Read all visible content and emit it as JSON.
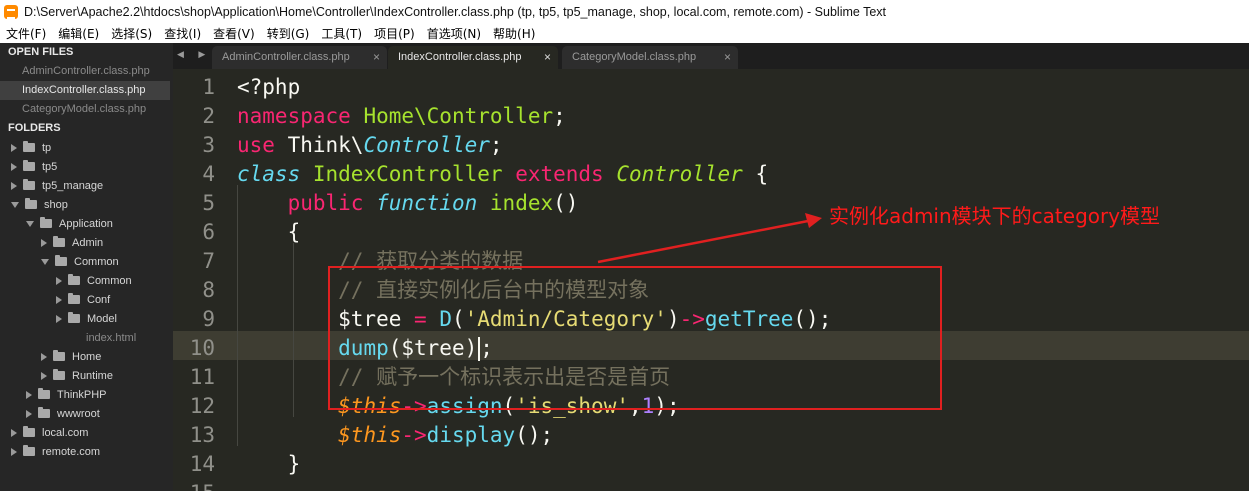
{
  "window": {
    "title": "D:\\Server\\Apache2.2\\htdocs\\shop\\Application\\Home\\Controller\\IndexController.class.php (tp, tp5, tp5_manage, shop, local.com, remote.com) - Sublime Text"
  },
  "menu": [
    "文件(F)",
    "编辑(E)",
    "选择(S)",
    "查找(I)",
    "查看(V)",
    "转到(G)",
    "工具(T)",
    "项目(P)",
    "首选项(N)",
    "帮助(H)"
  ],
  "sidebar": {
    "open_files_header": "OPEN FILES",
    "open_files": [
      "AdminController.class.php",
      "IndexController.class.php",
      "CategoryModel.class.php"
    ],
    "folders_header": "FOLDERS",
    "tree": [
      {
        "label": "tp",
        "type": "folder",
        "expanded": false,
        "depth": 0
      },
      {
        "label": "tp5",
        "type": "folder",
        "expanded": false,
        "depth": 0
      },
      {
        "label": "tp5_manage",
        "type": "folder",
        "expanded": false,
        "depth": 0
      },
      {
        "label": "shop",
        "type": "folder",
        "expanded": true,
        "depth": 0
      },
      {
        "label": "Application",
        "type": "folder",
        "expanded": true,
        "depth": 1
      },
      {
        "label": "Admin",
        "type": "folder",
        "expanded": false,
        "depth": 2
      },
      {
        "label": "Common",
        "type": "folder",
        "expanded": true,
        "depth": 2
      },
      {
        "label": "Common",
        "type": "folder",
        "expanded": false,
        "depth": 3
      },
      {
        "label": "Conf",
        "type": "folder",
        "expanded": false,
        "depth": 3
      },
      {
        "label": "Model",
        "type": "folder",
        "expanded": false,
        "depth": 3
      },
      {
        "label": "index.html",
        "type": "file",
        "expanded": false,
        "depth": 3
      },
      {
        "label": "Home",
        "type": "folder",
        "expanded": false,
        "depth": 2
      },
      {
        "label": "Runtime",
        "type": "folder",
        "expanded": false,
        "depth": 2
      },
      {
        "label": "ThinkPHP",
        "type": "folder",
        "expanded": false,
        "depth": 1
      },
      {
        "label": "wwwroot",
        "type": "folder",
        "expanded": false,
        "depth": 1
      },
      {
        "label": "local.com",
        "type": "folder",
        "expanded": false,
        "depth": 0
      },
      {
        "label": "remote.com",
        "type": "folder",
        "expanded": false,
        "depth": 0
      }
    ]
  },
  "tabs": [
    {
      "label": "AdminController.class.php",
      "close": "×"
    },
    {
      "label": "IndexController.class.php",
      "close": "×"
    },
    {
      "label": "CategoryModel.class.php",
      "close": "×"
    }
  ],
  "tab_nav": "◀ ▶",
  "editor": {
    "line_numbers": [
      "1",
      "2",
      "3",
      "4",
      "5",
      "6",
      "7",
      "8",
      "9",
      "10",
      "11",
      "12",
      "13",
      "14",
      "15"
    ],
    "current_line": "10",
    "lines": [
      [
        {
          "t": "<?php",
          "c": ""
        }
      ],
      [
        {
          "t": "namespace",
          "c": "k-pink"
        },
        {
          "t": " ",
          "c": ""
        },
        {
          "t": "Home\\Controller",
          "c": "k-green"
        },
        {
          "t": ";",
          "c": ""
        }
      ],
      [
        {
          "t": "use",
          "c": "k-pink"
        },
        {
          "t": " Think\\",
          "c": ""
        },
        {
          "t": "Controller",
          "c": "k-blue k-ital"
        },
        {
          "t": ";",
          "c": ""
        }
      ],
      [
        {
          "t": "class",
          "c": "k-blue k-ital"
        },
        {
          "t": " ",
          "c": ""
        },
        {
          "t": "IndexController",
          "c": "k-green"
        },
        {
          "t": " ",
          "c": ""
        },
        {
          "t": "extends",
          "c": "k-pink"
        },
        {
          "t": " ",
          "c": ""
        },
        {
          "t": "Controller",
          "c": "k-green k-ital"
        },
        {
          "t": " {",
          "c": ""
        }
      ],
      [
        {
          "t": "    ",
          "c": ""
        },
        {
          "t": "public",
          "c": "k-pink"
        },
        {
          "t": " ",
          "c": ""
        },
        {
          "t": "function",
          "c": "k-blue k-ital"
        },
        {
          "t": " ",
          "c": ""
        },
        {
          "t": "index",
          "c": "k-green"
        },
        {
          "t": "()",
          "c": ""
        }
      ],
      [
        {
          "t": "    {",
          "c": ""
        }
      ],
      [
        {
          "t": "        // 获取分类的数据",
          "c": "k-comment"
        }
      ],
      [
        {
          "t": "        // 直接实例化后台中的模型对象",
          "c": "k-comment"
        }
      ],
      [
        {
          "t": "        $tree ",
          "c": ""
        },
        {
          "t": "=",
          "c": "k-pink"
        },
        {
          "t": " ",
          "c": ""
        },
        {
          "t": "D",
          "c": "k-blue"
        },
        {
          "t": "(",
          "c": ""
        },
        {
          "t": "'Admin/Category'",
          "c": "k-yellow"
        },
        {
          "t": ")",
          "c": ""
        },
        {
          "t": "->",
          "c": "k-pink"
        },
        {
          "t": "getTree",
          "c": "k-blue"
        },
        {
          "t": "();",
          "c": ""
        }
      ],
      [
        {
          "t": "        ",
          "c": ""
        },
        {
          "t": "dump",
          "c": "k-blue"
        },
        {
          "t": "($tree)",
          "c": ""
        },
        {
          "t": "",
          "c": "cursor"
        },
        {
          "t": ";",
          "c": ""
        }
      ],
      [
        {
          "t": "        // 赋予一个标识表示出是否是首页",
          "c": "k-comment"
        }
      ],
      [
        {
          "t": "        ",
          "c": ""
        },
        {
          "t": "$this",
          "c": "k-orange k-ital"
        },
        {
          "t": "->",
          "c": "k-pink"
        },
        {
          "t": "assign",
          "c": "k-blue"
        },
        {
          "t": "(",
          "c": ""
        },
        {
          "t": "'is_show'",
          "c": "k-yellow"
        },
        {
          "t": ",",
          "c": ""
        },
        {
          "t": "1",
          "c": "k-purple"
        },
        {
          "t": ");",
          "c": ""
        }
      ],
      [
        {
          "t": "        ",
          "c": ""
        },
        {
          "t": "$this",
          "c": "k-orange k-ital"
        },
        {
          "t": "->",
          "c": "k-pink"
        },
        {
          "t": "display",
          "c": "k-blue"
        },
        {
          "t": "();",
          "c": ""
        }
      ],
      [
        {
          "t": "    }",
          "c": ""
        }
      ],
      [
        {
          "t": "",
          "c": ""
        }
      ]
    ]
  },
  "annotation": {
    "text": "实例化admin模块下的category模型",
    "color": "#ff1a1a"
  },
  "colors": {
    "editor_bg": "#272822",
    "sidebar_bg": "#262626",
    "keyword": "#f92672",
    "function": "#a6e22e",
    "type": "#66d9ef",
    "string": "#e6db74",
    "number": "#ae81ff",
    "comment": "#75715e"
  }
}
